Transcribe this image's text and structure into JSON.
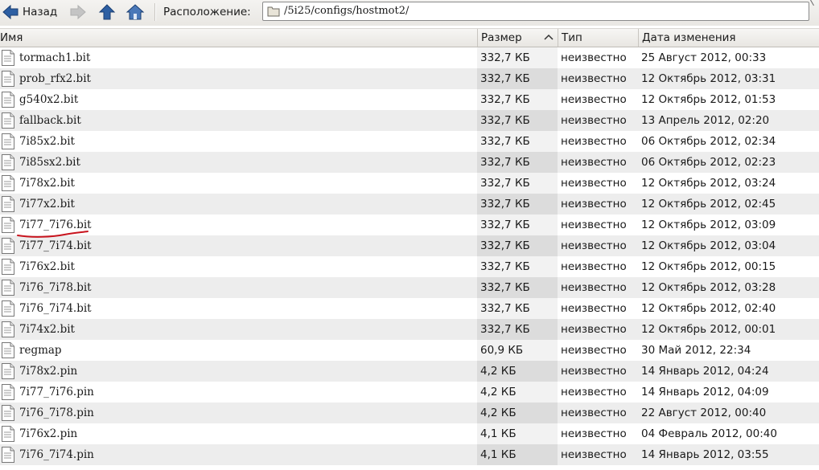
{
  "toolbar": {
    "back_label": "Назад",
    "location_label": "Расположение:",
    "path": "/5i25/configs/hostmot2/"
  },
  "columns": {
    "name": "Имя",
    "size": "Размер",
    "type": "Тип",
    "date": "Дата изменения"
  },
  "files": [
    {
      "name": "tormach1.bit",
      "size": "332,7 КБ",
      "type": "неизвестно",
      "date": "25 Август 2012, 00:33"
    },
    {
      "name": "prob_rfx2.bit",
      "size": "332,7 КБ",
      "type": "неизвестно",
      "date": "12 Октябрь 2012, 03:31"
    },
    {
      "name": "g540x2.bit",
      "size": "332,7 КБ",
      "type": "неизвестно",
      "date": "12 Октябрь 2012, 01:53"
    },
    {
      "name": "fallback.bit",
      "size": "332,7 КБ",
      "type": "неизвестно",
      "date": "13 Апрель 2012, 02:20"
    },
    {
      "name": "7i85x2.bit",
      "size": "332,7 КБ",
      "type": "неизвестно",
      "date": "06 Октябрь 2012, 02:34"
    },
    {
      "name": "7i85sx2.bit",
      "size": "332,7 КБ",
      "type": "неизвестно",
      "date": "06 Октябрь 2012, 02:23"
    },
    {
      "name": "7i78x2.bit",
      "size": "332,7 КБ",
      "type": "неизвестно",
      "date": "12 Октябрь 2012, 03:24"
    },
    {
      "name": "7i77x2.bit",
      "size": "332,7 КБ",
      "type": "неизвестно",
      "date": "12 Октябрь 2012, 02:45"
    },
    {
      "name": "7i77_7i76.bit",
      "size": "332,7 КБ",
      "type": "неизвестно",
      "date": "12 Октябрь 2012, 03:09"
    },
    {
      "name": "7i77_7i74.bit",
      "size": "332,7 КБ",
      "type": "неизвестно",
      "date": "12 Октябрь 2012, 03:04"
    },
    {
      "name": "7i76x2.bit",
      "size": "332,7 КБ",
      "type": "неизвестно",
      "date": "12 Октябрь 2012, 00:15"
    },
    {
      "name": "7i76_7i78.bit",
      "size": "332,7 КБ",
      "type": "неизвестно",
      "date": "12 Октябрь 2012, 03:28"
    },
    {
      "name": "7i76_7i74.bit",
      "size": "332,7 КБ",
      "type": "неизвестно",
      "date": "12 Октябрь 2012, 02:40"
    },
    {
      "name": "7i74x2.bit",
      "size": "332,7 КБ",
      "type": "неизвестно",
      "date": "12 Октябрь 2012, 00:01"
    },
    {
      "name": "regmap",
      "size": "60,9 КБ",
      "type": "неизвестно",
      "date": "30 Май 2012, 22:34"
    },
    {
      "name": "7i78x2.pin",
      "size": "4,2 КБ",
      "type": "неизвестно",
      "date": "14 Январь 2012, 04:24"
    },
    {
      "name": "7i77_7i76.pin",
      "size": "4,2 КБ",
      "type": "неизвестно",
      "date": "14 Январь 2012, 04:09"
    },
    {
      "name": "7i76_7i78.pin",
      "size": "4,2 КБ",
      "type": "неизвестно",
      "date": "22 Август 2012, 00:40"
    },
    {
      "name": "7i76x2.pin",
      "size": "4,1 КБ",
      "type": "неизвестно",
      "date": "04 Февраль 2012, 00:40"
    },
    {
      "name": "7i76_7i74.pin",
      "size": "4,1 КБ",
      "type": "неизвестно",
      "date": "14 Январь 2012, 03:55"
    }
  ],
  "icons": {
    "back": "arrow-left-icon",
    "forward": "arrow-right-icon",
    "up": "arrow-up-icon",
    "home": "home-icon",
    "folder": "folder-icon",
    "file": "document-icon",
    "sort": "sort-ascending-icon"
  },
  "colors": {
    "accent": "#2d5fa3",
    "row_alt": "#ededed",
    "annotation": "#c8141e"
  }
}
